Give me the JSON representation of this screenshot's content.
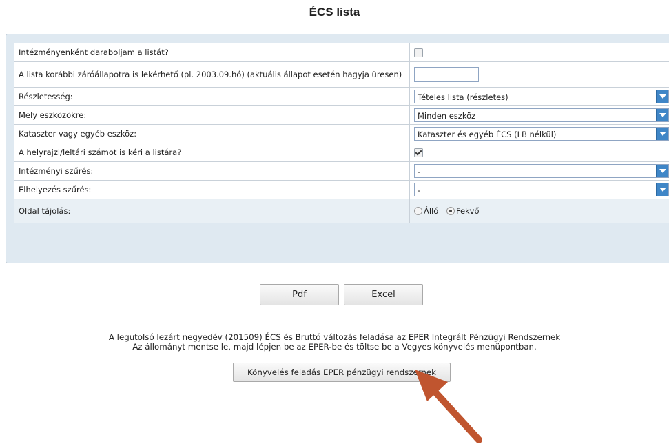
{
  "page": {
    "title": "ÉCS lista"
  },
  "form": {
    "rows": {
      "split": {
        "label": "Intézményenként daraboljam a listát?",
        "checked": false
      },
      "closing_state": {
        "label": "A lista korábbi záróállapotra is lekérhető (pl. 2003.09.hó) (aktuális állapot esetén hagyja üresen)",
        "value": ""
      },
      "detail": {
        "label": "Részletesség:",
        "value": "Tételes lista (részletes)"
      },
      "assets": {
        "label": "Mely eszközökre:",
        "value": "Minden eszköz"
      },
      "cadastre": {
        "label": "Kataszter vagy egyéb eszköz:",
        "value": "Kataszter és egyéb ÉCS (LB nélkül)"
      },
      "parcel_number": {
        "label": "A helyrajzi/leltári számot is kéri a listára?",
        "checked": true
      },
      "institution_filter": {
        "label": "Intézményi szűrés:",
        "value": "-"
      },
      "location_filter": {
        "label": "Elhelyezés szűrés:",
        "value": "-"
      },
      "orientation": {
        "label": "Oldal tájolás:",
        "options": [
          "Álló",
          "Fekvő"
        ],
        "selected": "Fekvő"
      }
    }
  },
  "actions": {
    "pdf_label": "Pdf",
    "excel_label": "Excel"
  },
  "info": {
    "line1": "A legutolsó lezárt negyedév (201509) ÉCS és Bruttó változás feladása az EPER Integrált Pénzügyi Rendszernek",
    "line2": "Az állományt mentse le, majd lépjen be az EPER-be és töltse be a Vegyes könyvelés menüpontban.",
    "button_label": "Könyvelés feladás EPER pénzügyi rendszernek"
  },
  "annotation": {
    "arrow_color": "#c0552f"
  }
}
